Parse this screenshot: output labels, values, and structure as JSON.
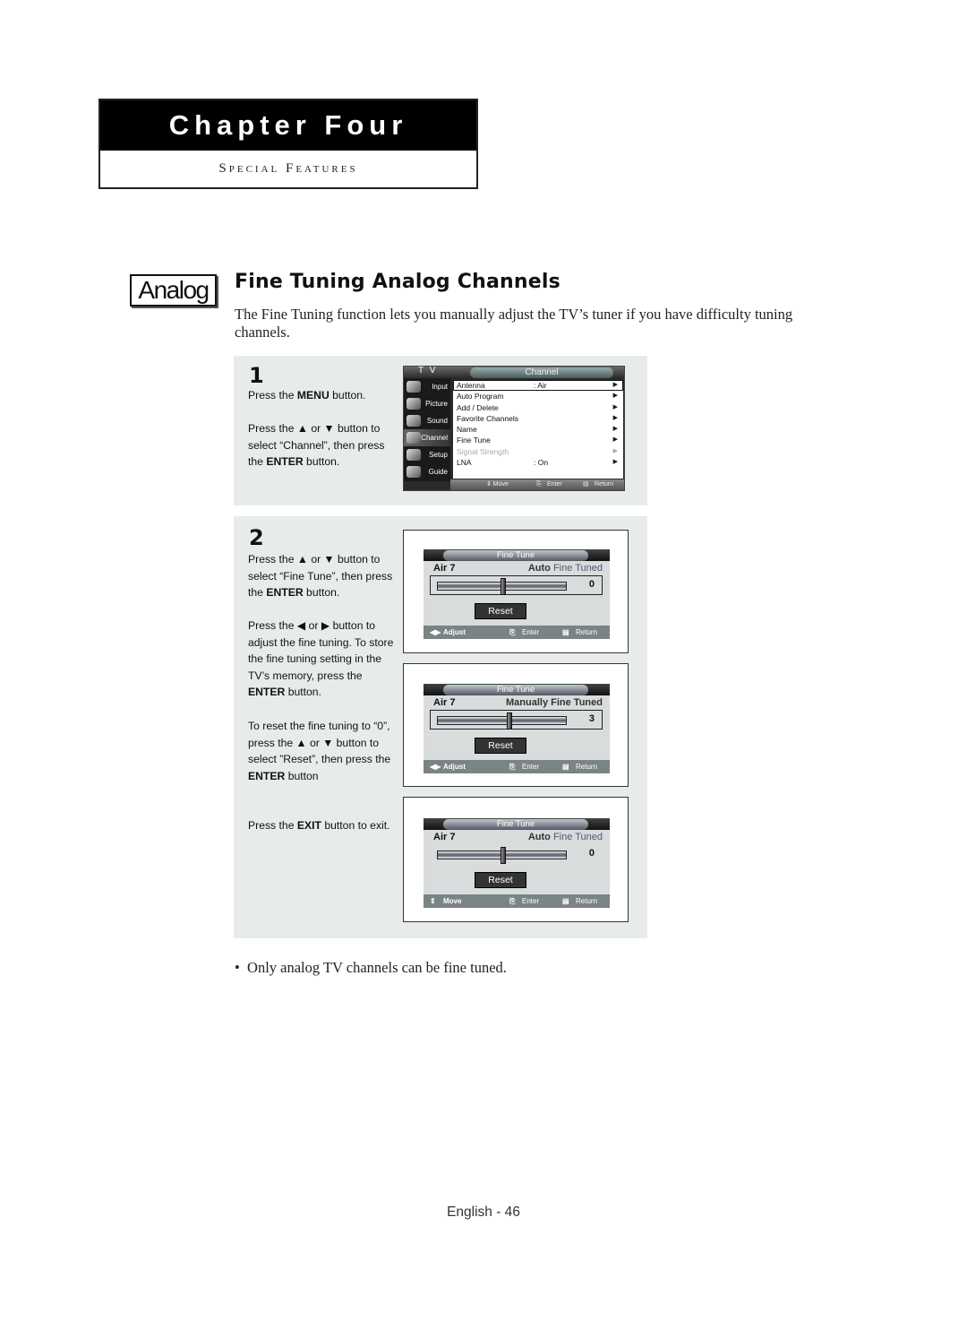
{
  "chapter": {
    "title": "Chapter Four",
    "subtitle": "Special Features"
  },
  "section": {
    "badge": "Analog",
    "title": "Fine Tuning Analog Channels",
    "intro": "The Fine Tuning function lets you manually adjust the TV’s tuner if you have difficulty tuning channels."
  },
  "step1": {
    "number": "1",
    "p1": {
      "pre": "Press the ",
      "bold": "MENU",
      "post": " button."
    },
    "p2": {
      "pre": "Press the ▲ or ▼ button to select “Channel”, then press the ",
      "bold": "ENTER",
      "post": " button."
    },
    "screen": {
      "header_left": "T V",
      "header_title": "Channel",
      "sidebar": [
        "Input",
        "Picture",
        "Sound",
        "Channel",
        "Setup",
        "Guide"
      ],
      "active_sidebar": "Channel",
      "items": [
        {
          "label": "Antenna",
          "value": ": Air",
          "selected": true,
          "disabled": false
        },
        {
          "label": "Auto Program",
          "value": "",
          "selected": false,
          "disabled": false
        },
        {
          "label": "Add / Delete",
          "value": "",
          "selected": false,
          "disabled": false
        },
        {
          "label": "Favorite Channels",
          "value": "",
          "selected": false,
          "disabled": false
        },
        {
          "label": "Name",
          "value": "",
          "selected": false,
          "disabled": false
        },
        {
          "label": "Fine Tune",
          "value": "",
          "selected": false,
          "disabled": false
        },
        {
          "label": "Signal Strength",
          "value": "",
          "selected": false,
          "disabled": true
        },
        {
          "label": "LNA",
          "value": ": On",
          "selected": false,
          "disabled": false
        }
      ],
      "arrow": "▶",
      "footer": {
        "move": "⇕ Move",
        "enter": "Enter",
        "return": "Return"
      }
    }
  },
  "step2": {
    "number": "2",
    "p1": {
      "pre": "Press the ▲ or ▼ button to select “Fine Tune”, then press the ",
      "bold": "ENTER",
      "post": " button."
    },
    "p2": {
      "pre": "Press the ◀ or ▶ button to adjust the fine tuning. To store the fine tuning setting in the TV’s memory, press the ",
      "bold": "ENTER",
      "post": " button."
    },
    "p3": {
      "pre": "To reset the fine tuning to “0”, press the ▲ or ▼ button to select ”Reset”, then press the ",
      "bold": "ENTER",
      "post": " button"
    },
    "p4": {
      "pre": "Press the ",
      "bold": "EXIT",
      "post": " button to exit."
    },
    "screens": [
      {
        "title": "Fine Tune",
        "channel": "Air 7",
        "status_a": "Auto",
        "status_b": "Fine Tuned",
        "value": "0",
        "position_fraction": 0.5,
        "reset": "Reset",
        "footer_left": "Adjust",
        "footer_left_icon": "◀▶",
        "footer_enter": "Enter",
        "footer_return": "Return"
      },
      {
        "title": "Fine Tune",
        "channel": "Air 7",
        "status_a": "Manually Fine Tuned",
        "status_b": "",
        "value": "3",
        "position_fraction": 0.55,
        "reset": "Reset",
        "footer_left": "Adjust",
        "footer_left_icon": "◀▶",
        "footer_enter": "Enter",
        "footer_return": "Return"
      },
      {
        "title": "Fine Tune",
        "channel": "Air 7",
        "status_a": "Auto",
        "status_b": "Fine Tuned",
        "value": "0",
        "position_fraction": 0.5,
        "reset": "Reset",
        "footer_left": "Move",
        "footer_left_icon": "⇕",
        "footer_enter": "Enter",
        "footer_return": "Return"
      }
    ]
  },
  "note": "Only analog TV channels can be fine tuned.",
  "footer": "English - 46"
}
